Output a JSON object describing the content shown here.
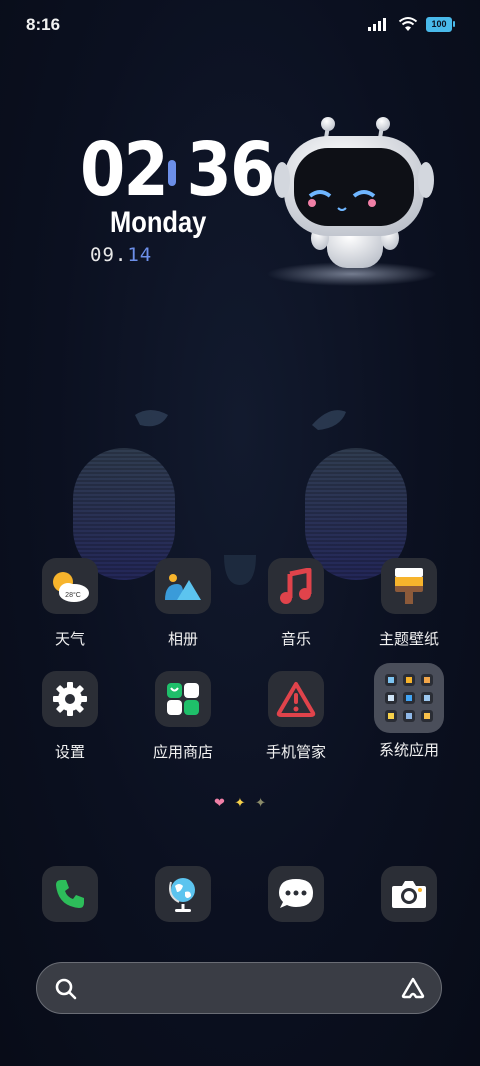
{
  "status_bar": {
    "time": "8:16",
    "battery": "100",
    "icons": [
      "signal-icon",
      "wifi-icon",
      "battery-icon"
    ]
  },
  "clock": {
    "hours": "02",
    "minutes": "36",
    "day": "Monday",
    "date_month": "09.",
    "date_day": "14"
  },
  "apps": [
    {
      "name": "weather",
      "label": "天气",
      "badge": "28°C"
    },
    {
      "name": "gallery",
      "label": "相册"
    },
    {
      "name": "music",
      "label": "音乐"
    },
    {
      "name": "themes",
      "label": "主题壁纸"
    },
    {
      "name": "settings",
      "label": "设置"
    },
    {
      "name": "app-store",
      "label": "应用商店"
    },
    {
      "name": "phone-manager",
      "label": "手机管家"
    },
    {
      "name": "system-apps",
      "label": "系统应用"
    }
  ],
  "dock": [
    "phone",
    "browser",
    "messages",
    "camera"
  ],
  "page_indicator": {
    "active": "heart",
    "others": [
      "sparkle",
      "sparkle"
    ]
  },
  "search": {
    "placeholder": ""
  },
  "colors": {
    "accent": "#6c8fe8",
    "battery": "#49b9ea",
    "phone": "#2dbd5a",
    "music": "#e0434b"
  }
}
